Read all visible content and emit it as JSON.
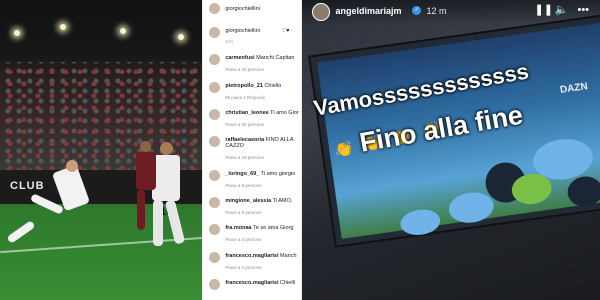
{
  "photo": {
    "ad_text": "CLUB",
    "player_number": "10"
  },
  "comments": {
    "header_user": "giorgiochiellini",
    "caption_user": "giorgiochiellini",
    "caption_meta": "4 m",
    "items": [
      {
        "user": "carmenfusi",
        "text": "Manchi Capitan",
        "meta": "Piace a 20 persone"
      },
      {
        "user": "pietropollo_21",
        "text": "Chiello",
        "meta": "Mi piace 1  Rispondi"
      },
      {
        "user": "christian_leonee",
        "text": "Ti amo Gior",
        "meta": "Piace a 30 persone"
      },
      {
        "user": "raffaelecasoria",
        "text": "FINO ALLA CAZZO",
        "meta": "Piace a 18 persone"
      },
      {
        "user": "_loringo_69_",
        "text": "Ti amo giorgio",
        "meta": "Piace a 9 persone"
      },
      {
        "user": "mingione_alessia",
        "text": "Ti AMO,",
        "meta": "Piace a 5 persone"
      },
      {
        "user": "fra.monaa",
        "text": "Te se ama Giorg",
        "meta": "Piace a 3 persone"
      },
      {
        "user": "francesco.magliarisi",
        "text": "Manch",
        "meta": "Piace a 2 persone"
      },
      {
        "user": "francesco.magliarisi",
        "text": "Chielli",
        "meta": ""
      }
    ]
  },
  "story": {
    "username": "angeldimariajm",
    "time": "12 m",
    "line1": "Vamosssssssssssss",
    "line2": "Fino alla fine",
    "tv_logo": "DAZN",
    "emojis": [
      "👏",
      "👏",
      "👏",
      "👏"
    ],
    "icons": [
      "pause-icon",
      "mute-icon",
      "more-icon"
    ]
  }
}
